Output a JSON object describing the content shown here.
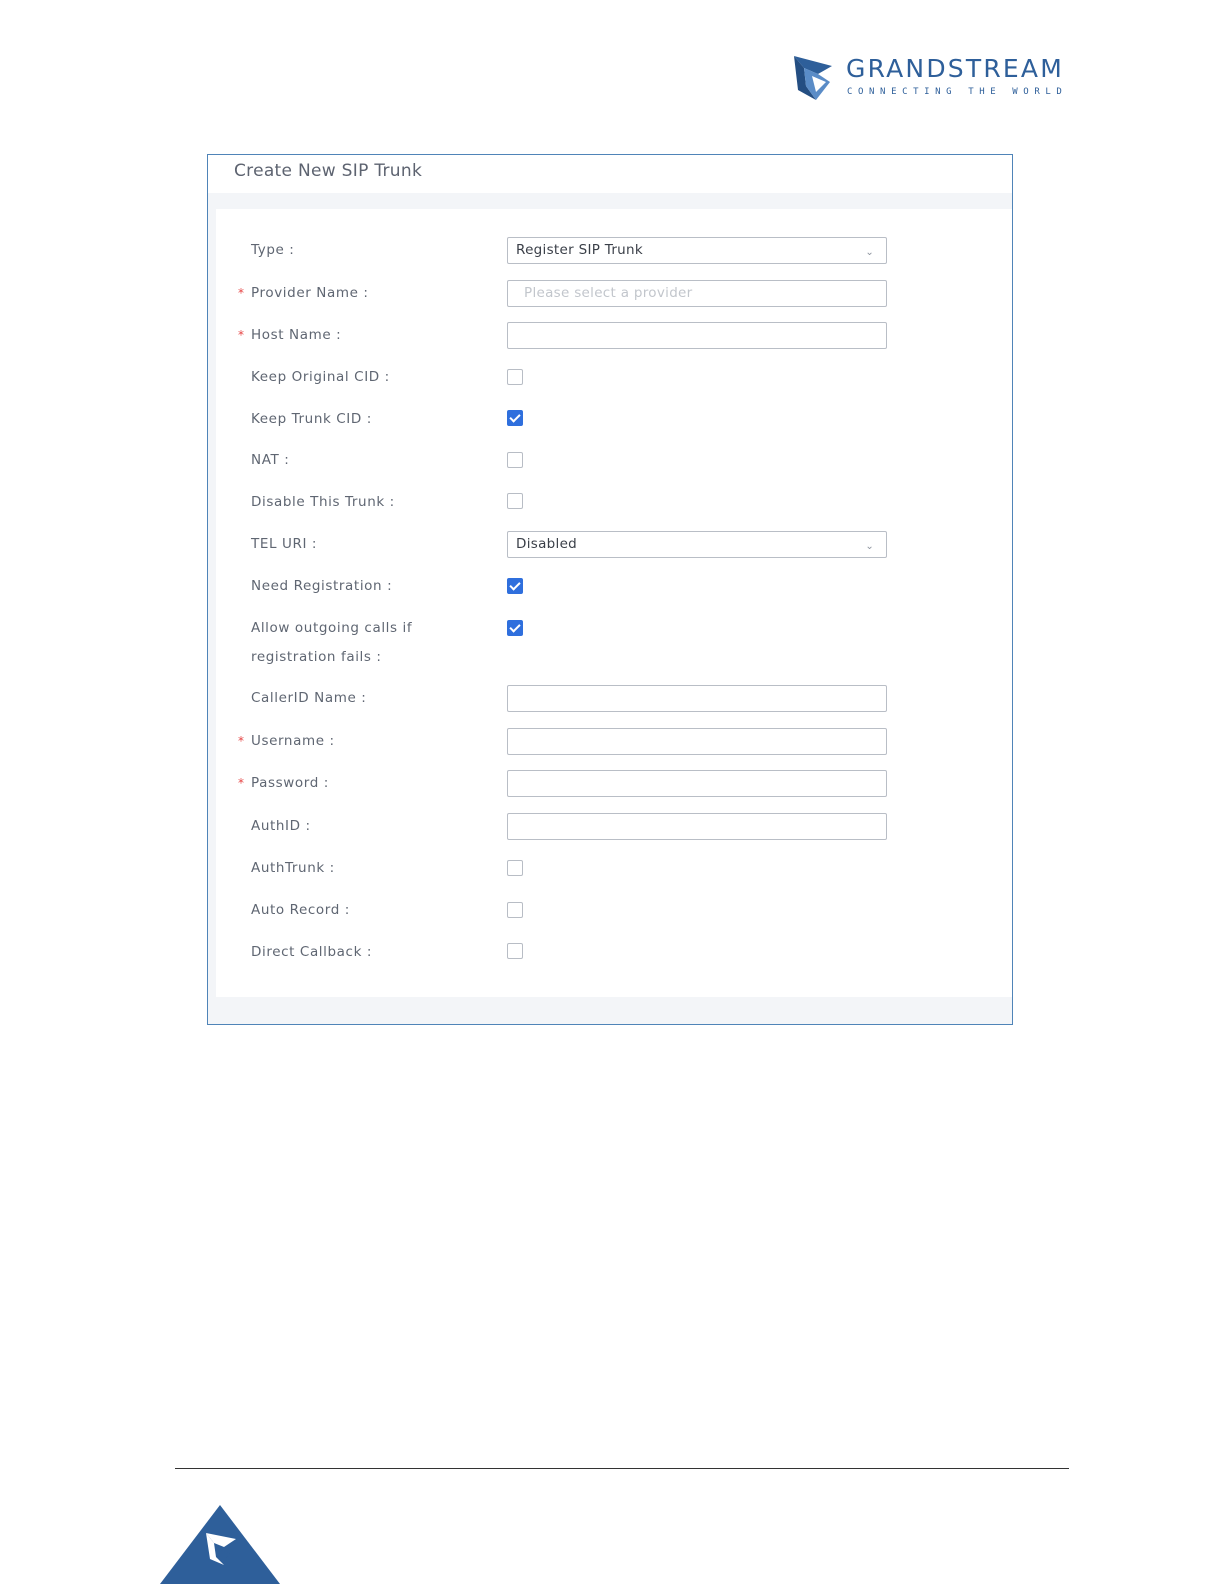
{
  "header": {
    "brand_name": "GRANDSTREAM",
    "brand_tagline": "CONNECTING THE WORLD",
    "logo_icon": "grandstream-logo-icon",
    "brand_color": "#2e5f9a"
  },
  "dialog": {
    "title": "Create New SIP Trunk",
    "border_color": "#4f84b8"
  },
  "form": {
    "type": {
      "label": "Type :",
      "value": "Register SIP Trunk",
      "required": false
    },
    "provider_name": {
      "label": "Provider Name :",
      "placeholder": "Please select a provider",
      "value": "",
      "required": true
    },
    "host_name": {
      "label": "Host Name :",
      "value": "",
      "required": true
    },
    "keep_original_cid": {
      "label": "Keep Original CID :",
      "checked": false
    },
    "keep_trunk_cid": {
      "label": "Keep Trunk CID :",
      "checked": true
    },
    "nat": {
      "label": "NAT :",
      "checked": false
    },
    "disable_this_trunk": {
      "label": "Disable This Trunk :",
      "checked": false
    },
    "tel_uri": {
      "label": "TEL URI :",
      "value": "Disabled"
    },
    "need_registration": {
      "label": "Need Registration :",
      "checked": true
    },
    "allow_outgoing_calls": {
      "label_line1": "Allow outgoing calls if",
      "label_line2": "registration fails :",
      "checked": true
    },
    "callerid_name": {
      "label": "CallerID Name :",
      "value": ""
    },
    "username": {
      "label": "Username :",
      "value": "",
      "required": true
    },
    "password": {
      "label": "Password :",
      "value": "",
      "required": true
    },
    "authid": {
      "label": "AuthID :",
      "value": ""
    },
    "authtrunk": {
      "label": "AuthTrunk :",
      "checked": false
    },
    "auto_record": {
      "label": "Auto Record :",
      "checked": false
    },
    "direct_callback": {
      "label": "Direct Callback :",
      "checked": false
    },
    "required_marker": "*",
    "checkbox_color": "#2f6fdd",
    "required_color": "#e64545"
  },
  "footer": {
    "logo_icon": "grandstream-corner-logo-icon"
  }
}
